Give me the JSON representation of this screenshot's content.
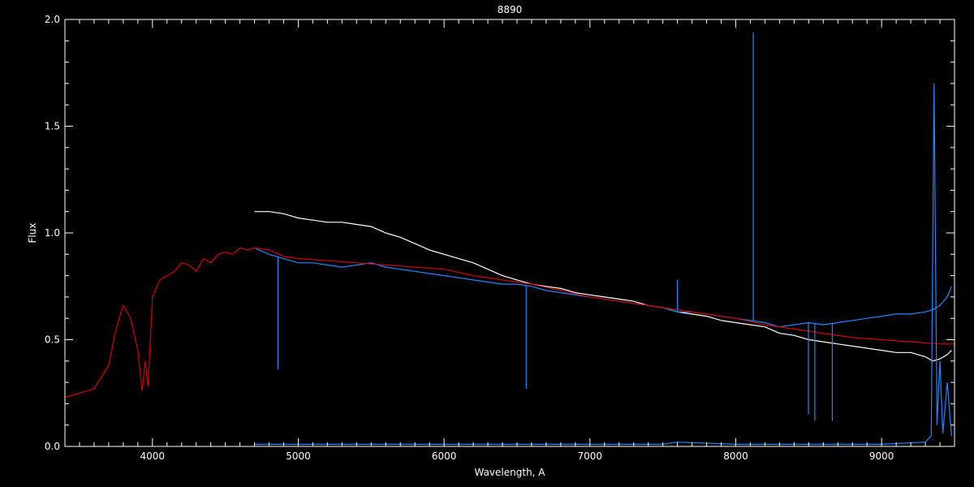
{
  "chart_data": {
    "type": "line",
    "title": "8890",
    "xlabel": "Wavelength, A",
    "ylabel": "Flux",
    "xlim": [
      3400,
      9500
    ],
    "ylim": [
      0,
      2.0
    ],
    "xticks": [
      4000,
      5000,
      6000,
      7000,
      8000,
      9000
    ],
    "xtick_labels": [
      "4000",
      "5000",
      "6000",
      "7000",
      "8000",
      "9000"
    ],
    "yticks": [
      0,
      0.5,
      1.0,
      1.5,
      2.0
    ],
    "ytick_labels": [
      "0.0",
      "0.5",
      "1.0",
      "1.5",
      "2.0"
    ],
    "grid": false,
    "legend": "none",
    "colors": {
      "background": "#000000",
      "axes": "#ffffff",
      "white_series": "#ffffff",
      "blue_series": "#1e88ff",
      "red_series": "#d40000"
    },
    "series": [
      {
        "color": "white",
        "x": [
          4700,
          4800,
          4900,
          5000,
          5100,
          5200,
          5300,
          5400,
          5500,
          5600,
          5700,
          5800,
          5900,
          6000,
          6100,
          6200,
          6300,
          6400,
          6500,
          6600,
          6700,
          6800,
          6900,
          7000,
          7100,
          7200,
          7300,
          7400,
          7500,
          7600,
          7700,
          7800,
          7900,
          8000,
          8100,
          8200,
          8300,
          8400,
          8500,
          8600,
          8700,
          8800,
          8900,
          9000,
          9100,
          9200,
          9300,
          9350,
          9400,
          9450,
          9480
        ],
        "y": [
          1.1,
          1.1,
          1.09,
          1.07,
          1.06,
          1.05,
          1.05,
          1.04,
          1.03,
          1.0,
          0.98,
          0.95,
          0.92,
          0.9,
          0.88,
          0.86,
          0.83,
          0.8,
          0.78,
          0.76,
          0.75,
          0.74,
          0.72,
          0.71,
          0.7,
          0.69,
          0.68,
          0.66,
          0.65,
          0.63,
          0.62,
          0.61,
          0.59,
          0.58,
          0.57,
          0.56,
          0.53,
          0.52,
          0.5,
          0.49,
          0.48,
          0.47,
          0.46,
          0.45,
          0.44,
          0.44,
          0.42,
          0.4,
          0.41,
          0.43,
          0.45
        ]
      },
      {
        "color": "blue",
        "x": [
          4700,
          4800,
          4900,
          5000,
          5100,
          5200,
          5300,
          5400,
          5500,
          5600,
          5700,
          5800,
          5900,
          6000,
          6100,
          6200,
          6300,
          6400,
          6500,
          6600,
          6700,
          6800,
          6900,
          7000,
          7100,
          7200,
          7300,
          7400,
          7500,
          7600,
          7700,
          7800,
          7900,
          8000,
          8100,
          8200,
          8300,
          8400,
          8500,
          8600,
          8700,
          8800,
          8900,
          9000,
          9100,
          9200,
          9300,
          9350,
          9400,
          9450,
          9480
        ],
        "y": [
          0.93,
          0.9,
          0.88,
          0.86,
          0.86,
          0.85,
          0.84,
          0.85,
          0.86,
          0.84,
          0.83,
          0.82,
          0.81,
          0.8,
          0.79,
          0.78,
          0.77,
          0.76,
          0.76,
          0.75,
          0.73,
          0.72,
          0.71,
          0.7,
          0.69,
          0.68,
          0.67,
          0.66,
          0.65,
          0.63,
          0.63,
          0.62,
          0.61,
          0.6,
          0.59,
          0.58,
          0.56,
          0.57,
          0.58,
          0.57,
          0.58,
          0.59,
          0.6,
          0.61,
          0.62,
          0.62,
          0.63,
          0.64,
          0.66,
          0.7,
          0.75
        ]
      },
      {
        "color": "red",
        "x": [
          3400,
          3500,
          3600,
          3700,
          3750,
          3800,
          3850,
          3900,
          3930,
          3950,
          3970,
          4000,
          4050,
          4100,
          4150,
          4200,
          4250,
          4300,
          4350,
          4400,
          4450,
          4500,
          4550,
          4600,
          4650,
          4700,
          4800,
          4900,
          5000,
          5200,
          5400,
          5600,
          5800,
          6000,
          6200,
          6400,
          6600,
          6800,
          7000,
          7200,
          7400,
          7600,
          7800,
          8000,
          8200,
          8400,
          8600,
          8800,
          9000,
          9200,
          9400,
          9500
        ],
        "y": [
          0.23,
          0.25,
          0.27,
          0.38,
          0.55,
          0.66,
          0.6,
          0.45,
          0.26,
          0.4,
          0.28,
          0.7,
          0.78,
          0.8,
          0.82,
          0.86,
          0.85,
          0.82,
          0.88,
          0.86,
          0.9,
          0.91,
          0.9,
          0.93,
          0.92,
          0.93,
          0.92,
          0.89,
          0.88,
          0.87,
          0.86,
          0.85,
          0.84,
          0.83,
          0.8,
          0.78,
          0.76,
          0.73,
          0.7,
          0.68,
          0.66,
          0.64,
          0.62,
          0.6,
          0.57,
          0.55,
          0.53,
          0.51,
          0.5,
          0.49,
          0.48,
          0.48
        ]
      },
      {
        "color": "blue",
        "x": [
          4700,
          5000,
          5500,
          6000,
          6500,
          7000,
          7500,
          7600,
          8000,
          8500,
          9000,
          9300,
          9340,
          9360,
          9380,
          9400,
          9420,
          9450,
          9480
        ],
        "y": [
          0.01,
          0.01,
          0.01,
          0.01,
          0.01,
          0.01,
          0.01,
          0.02,
          0.01,
          0.01,
          0.01,
          0.02,
          0.05,
          1.7,
          0.1,
          0.4,
          0.06,
          0.3,
          0.05
        ]
      }
    ],
    "absorption_lines": [
      {
        "x": 4861,
        "y": 0.36
      },
      {
        "x": 6563,
        "y": 0.27
      },
      {
        "x": 8498,
        "y": 0.15
      },
      {
        "x": 8542,
        "y": 0.12
      },
      {
        "x": 8662,
        "y": 0.12
      }
    ],
    "emission_lines": [
      {
        "x": 8120,
        "y": 1.94
      },
      {
        "x": 7600,
        "y": 0.78
      }
    ]
  }
}
